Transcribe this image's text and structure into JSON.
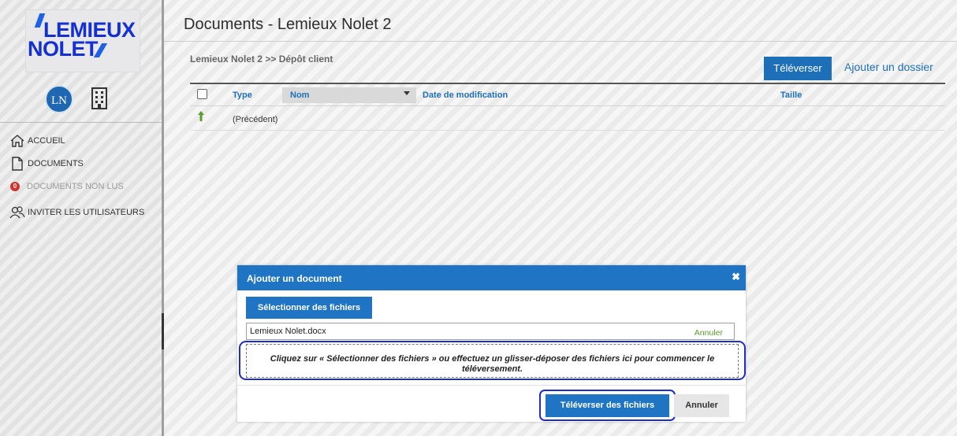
{
  "brand": {
    "logo_line1": "LEMIEUX",
    "logo_line2": "NOLET",
    "accent": "#1430d3"
  },
  "user": {
    "initials": "LN"
  },
  "sidebar": {
    "items": [
      {
        "label": "ACCUEIL",
        "icon": "home-icon"
      },
      {
        "label": "DOCUMENTS",
        "icon": "document-icon"
      },
      {
        "label": "DOCUMENTS NON LUS",
        "badge": "0"
      },
      {
        "label": "INVITER LES UTILISATEURS",
        "icon": "users-icon"
      }
    ]
  },
  "header": {
    "title": "Documents - Lemieux Nolet 2",
    "breadcrumb": "Lemieux Nolet 2 >> Dépôt client",
    "upload_label": "Téléverser",
    "add_folder_label": "Ajouter un dossier"
  },
  "table": {
    "columns": {
      "type": "Type",
      "name": "Nom",
      "date": "Date de modification",
      "size": "Taille"
    },
    "rows": [
      {
        "name": "(Précédent)"
      }
    ]
  },
  "modal": {
    "title": "Ajouter un document",
    "close": "✖",
    "select_label": "Sélectionner des fichiers",
    "file": {
      "name": "Lemieux Nolet.docx",
      "cancel": "Annuler"
    },
    "dropzone_text": "Cliquez sur « Sélectionner des fichiers » ou effectuez un glisser-déposer des fichiers ici pour commencer le téléversement.",
    "upload_files_label": "Téléverser des fichiers",
    "cancel_label": "Annuler"
  },
  "colors": {
    "primary": "#1f74c3",
    "highlight_outline": "#1f2ec6",
    "badge_red": "#d0312d",
    "cancel_green": "#5b9b2d"
  }
}
